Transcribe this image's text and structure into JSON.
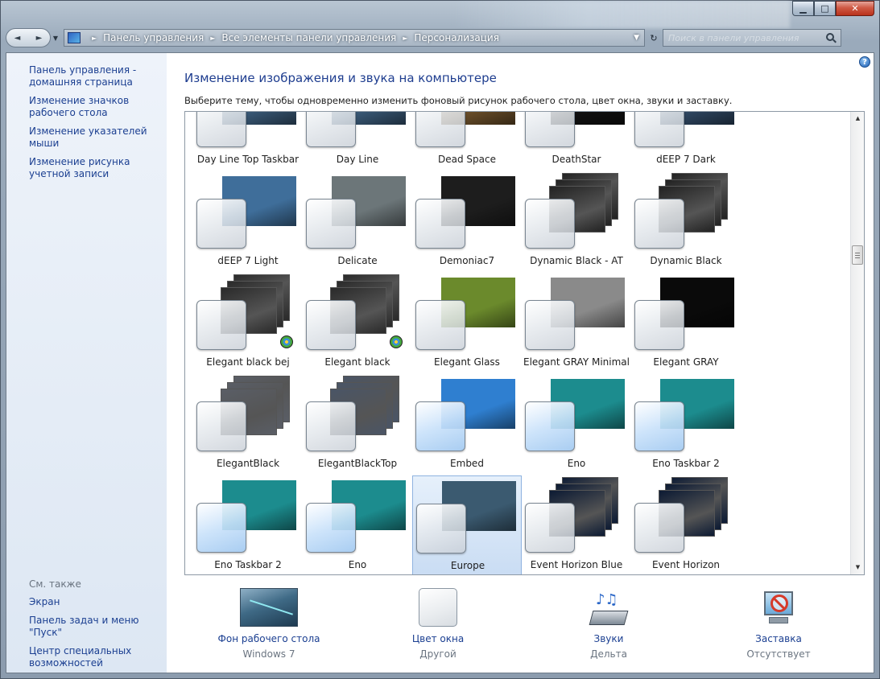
{
  "window": {
    "minimize": "▁",
    "maximize": "□",
    "close": "✕"
  },
  "nav": {
    "back": "◄",
    "forward": "►",
    "dropdown": "▼",
    "refresh": "↻",
    "breadcrumb": [
      "Панель управления",
      "Все элементы панели управления",
      "Персонализация"
    ],
    "search_placeholder": "Поиск в панели управления"
  },
  "sidebar": {
    "links": [
      "Панель управления - домашняя страница",
      "Изменение значков рабочего стола",
      "Изменение указателей мыши",
      "Изменение рисунка учетной записи"
    ],
    "see_also_title": "См. также",
    "see_also": [
      "Экран",
      "Панель задач и меню \"Пуск\"",
      "Центр специальных возможностей"
    ]
  },
  "main": {
    "title": "Изменение изображения и звука на компьютере",
    "subtitle": "Выберите тему, чтобы одновременно изменить фоновый рисунок рабочего стола, цвет окна, звуки и заставку.",
    "help": "?"
  },
  "themes": [
    {
      "label": "Day Line Top Taskbar",
      "bg": "#3a5a78",
      "style": "flat"
    },
    {
      "label": "Day Line",
      "bg": "#3a5a78",
      "style": "flat"
    },
    {
      "label": "Dead Space",
      "bg": "#6b4f2a",
      "style": "flat"
    },
    {
      "label": "DeathStar",
      "bg": "#111111",
      "style": "flat"
    },
    {
      "label": "dEEP 7 Dark",
      "bg": "#2f4762",
      "style": "flat"
    },
    {
      "label": "dEEP 7 Light",
      "bg": "#3f6e9a",
      "style": "flat"
    },
    {
      "label": "Delicate",
      "bg": "#6c7679",
      "style": "flat"
    },
    {
      "label": "Demoniac7",
      "bg": "#1d1d1d",
      "style": "flat"
    },
    {
      "label": "Dynamic Black - AT",
      "bg": "#222222",
      "style": "stack"
    },
    {
      "label": "Dynamic Black",
      "bg": "#222222",
      "style": "stack"
    },
    {
      "label": "Elegant black bej",
      "bg": "#2a2a2a",
      "style": "stack",
      "badge": true
    },
    {
      "label": "Elegant black",
      "bg": "#2a2a2a",
      "style": "stack",
      "badge": true
    },
    {
      "label": "Elegant Glass",
      "bg": "#6b8a2c",
      "style": "flat"
    },
    {
      "label": "Elegant GRAY Minimal",
      "bg": "#8a8a8a",
      "style": "flat"
    },
    {
      "label": "Elegant GRAY",
      "bg": "#0a0a0a",
      "style": "flat"
    },
    {
      "label": "ElegantBlack",
      "bg": "#5a5e66",
      "style": "stack"
    },
    {
      "label": "ElegantBlackTop",
      "bg": "#4a5566",
      "style": "stack"
    },
    {
      "label": "Embed",
      "bg": "#2f7fd0",
      "style": "flat",
      "blue": true
    },
    {
      "label": "Eno",
      "bg": "#1c8c8e",
      "style": "flat",
      "blue": true
    },
    {
      "label": "Eno Taskbar 2",
      "bg": "#1c8c8e",
      "style": "flat",
      "blue": true
    },
    {
      "label": "Eno Taskbar 2",
      "bg": "#1c8c8e",
      "style": "flat",
      "blue": true
    },
    {
      "label": "Eno",
      "bg": "#1c8c8e",
      "style": "flat",
      "blue": true
    },
    {
      "label": "Europe",
      "bg": "#3b5a70",
      "style": "flat",
      "selected": true
    },
    {
      "label": "Event Horizon Blue",
      "bg": "#0c1a33",
      "style": "stack"
    },
    {
      "label": "Event Horizon",
      "bg": "#0c1a33",
      "style": "stack"
    }
  ],
  "bottom": {
    "desktop_bg": {
      "label": "Фон рабочего стола",
      "value": "Windows 7"
    },
    "window_color": {
      "label": "Цвет окна",
      "value": "Другой"
    },
    "sounds": {
      "label": "Звуки",
      "value": "Дельта"
    },
    "screensaver": {
      "label": "Заставка",
      "value": "Отсутствует"
    }
  },
  "scroll": {
    "up": "▲",
    "down": "▼"
  }
}
